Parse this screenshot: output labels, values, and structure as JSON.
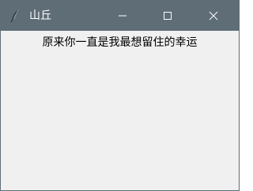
{
  "window": {
    "title": "山丘",
    "icon": "feather-icon",
    "controls": {
      "minimize": "minimize-icon",
      "maximize": "maximize-icon",
      "close": "close-icon"
    }
  },
  "main": {
    "label": "原来你一直是我最想留住的幸运"
  },
  "colors": {
    "titlebar": "#5f6d77",
    "content_bg": "#f0f0f0"
  }
}
